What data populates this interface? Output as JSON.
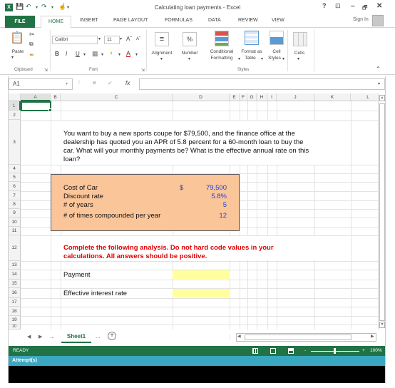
{
  "window": {
    "title": "Calculating loan payments - Excel",
    "logo": "X",
    "help": "?",
    "restore_ribbon": "⊡",
    "minimize": "–",
    "maximize": "🗗",
    "close": "✕"
  },
  "ribbon_tabs": [
    "FILE",
    "HOME",
    "INSERT",
    "PAGE LAYOUT",
    "FORMULAS",
    "DATA",
    "REVIEW",
    "VIEW"
  ],
  "sign_in": "Sign In",
  "ribbon": {
    "paste": "Paste",
    "font_name": "Calibri",
    "font_size": "11",
    "bold": "B",
    "italic": "I",
    "underline": "U",
    "alignment": "Alignment",
    "number": "Number",
    "number_symbol": "%",
    "conditional_formatting": [
      "Conditional",
      "Formatting"
    ],
    "format_as_table": [
      "Format as",
      "Table"
    ],
    "cell_styles": [
      "Cell",
      "Styles"
    ],
    "cells": "Cells",
    "groups": {
      "clipboard": "Clipboard",
      "font": "Font",
      "styles": "Styles"
    }
  },
  "formula_bar": {
    "name_box": "A1",
    "fx": "fx",
    "formula": ""
  },
  "columns": [
    "A",
    "B",
    "C",
    "D",
    "E",
    "F",
    "G",
    "H",
    "I",
    "J",
    "K",
    "L"
  ],
  "rows": [
    "1",
    "2",
    "3",
    "4",
    "5",
    "6",
    "7",
    "8",
    "9",
    "10",
    "11",
    "12",
    "13",
    "14",
    "15",
    "16",
    "17",
    "18",
    "19",
    "20"
  ],
  "sheet": {
    "problem_lines": [
      "You want to buy a new sports coupe for $79,500, and the finance office at the",
      "dealership has quoted you an APR of 5.8 percent for a 60-month loan to buy the",
      "car. What will your monthly payments be? What is the effective annual rate on this",
      "loan?"
    ],
    "inputs": [
      {
        "label": "Cost of Car",
        "currency": "$",
        "value": "79,500"
      },
      {
        "label": "Discount rate",
        "currency": "",
        "value": "5.8%"
      },
      {
        "label": "# of years",
        "currency": "",
        "value": "5"
      },
      {
        "label": "# of times compounded per year",
        "currency": "",
        "value": "12"
      }
    ],
    "instruction_lines": [
      "Complete the following analysis. Do not hard code values in your",
      "calculations. All answers should be positive."
    ],
    "payment_label": "Payment",
    "effective_rate_label": "Effective interest rate"
  },
  "sheet_tabs": {
    "active": "Sheet1",
    "ellipsis_left": "...",
    "ellipsis_right": "...",
    "add": "+"
  },
  "status_bar": {
    "ready": "READY",
    "zoom": "100%",
    "zoom_minus": "-",
    "zoom_plus": "+"
  },
  "attempt_label": "Attempt(s)",
  "colors": {
    "excel_green": "#217346",
    "input_box": "#fbc59a",
    "answer_cell": "#ffff9e",
    "instruction_red": "#e00000",
    "value_blue": "#1f3fcf",
    "attempt_bar": "#3aa8c1"
  }
}
